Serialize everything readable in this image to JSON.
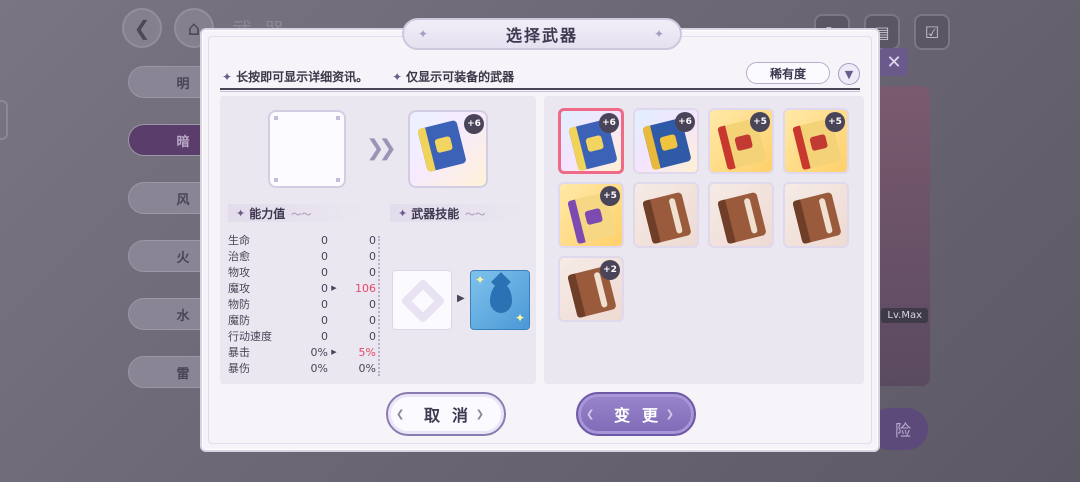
{
  "background": {
    "title": "武器",
    "tabs": [
      "明",
      "暗",
      "风",
      "火",
      "水",
      "雷"
    ],
    "active_tab": "暗",
    "card_badge": "Lv.Max",
    "bottom_button": "险"
  },
  "dialog": {
    "title": "选择武器",
    "hint_long_press": "长按即可显示详细资讯。",
    "hint_equippable": "仅显示可装备的武器",
    "sort_label": "稀有度",
    "target_plus": "+6",
    "stats_header": "能力值",
    "skills_header": "武器技能",
    "stats": [
      {
        "name": "生命",
        "current": "0",
        "new": "0",
        "arrow": false,
        "up": false
      },
      {
        "name": "治愈",
        "current": "0",
        "new": "0",
        "arrow": false,
        "up": false
      },
      {
        "name": "物攻",
        "current": "0",
        "new": "0",
        "arrow": false,
        "up": false
      },
      {
        "name": "魔攻",
        "current": "0",
        "new": "106",
        "arrow": true,
        "up": true
      },
      {
        "name": "物防",
        "current": "0",
        "new": "0",
        "arrow": false,
        "up": false
      },
      {
        "name": "魔防",
        "current": "0",
        "new": "0",
        "arrow": false,
        "up": false
      },
      {
        "name": "行动速度",
        "current": "0",
        "new": "0",
        "arrow": false,
        "up": false
      },
      {
        "name": "暴击",
        "current": "0%",
        "new": "5%",
        "arrow": true,
        "up": true
      },
      {
        "name": "暴伤",
        "current": "0%",
        "new": "0%",
        "arrow": false,
        "up": false
      }
    ],
    "weapons": [
      {
        "plus": "+6",
        "rarity": "rainbow",
        "book": "blue",
        "selected": true
      },
      {
        "plus": "+6",
        "rarity": "rainbow",
        "book": "gblue",
        "selected": false
      },
      {
        "plus": "+5",
        "rarity": "gold",
        "book": "red",
        "selected": false
      },
      {
        "plus": "+5",
        "rarity": "gold",
        "book": "red",
        "selected": false
      },
      {
        "plus": "+5",
        "rarity": "gold",
        "book": "purple",
        "selected": false
      },
      {
        "plus": "",
        "rarity": "bronze",
        "book": "brown",
        "selected": false
      },
      {
        "plus": "",
        "rarity": "bronze",
        "book": "brown",
        "selected": false
      },
      {
        "plus": "",
        "rarity": "bronze",
        "book": "brown",
        "selected": false
      },
      {
        "plus": "+2",
        "rarity": "bronze",
        "book": "brown",
        "selected": false
      }
    ],
    "cancel_label": "取消",
    "change_label": "变更"
  },
  "colors": {
    "accent": "#7e6ab6",
    "stat_increase": "#e04a6a",
    "selected_border": "#ee6a86"
  }
}
